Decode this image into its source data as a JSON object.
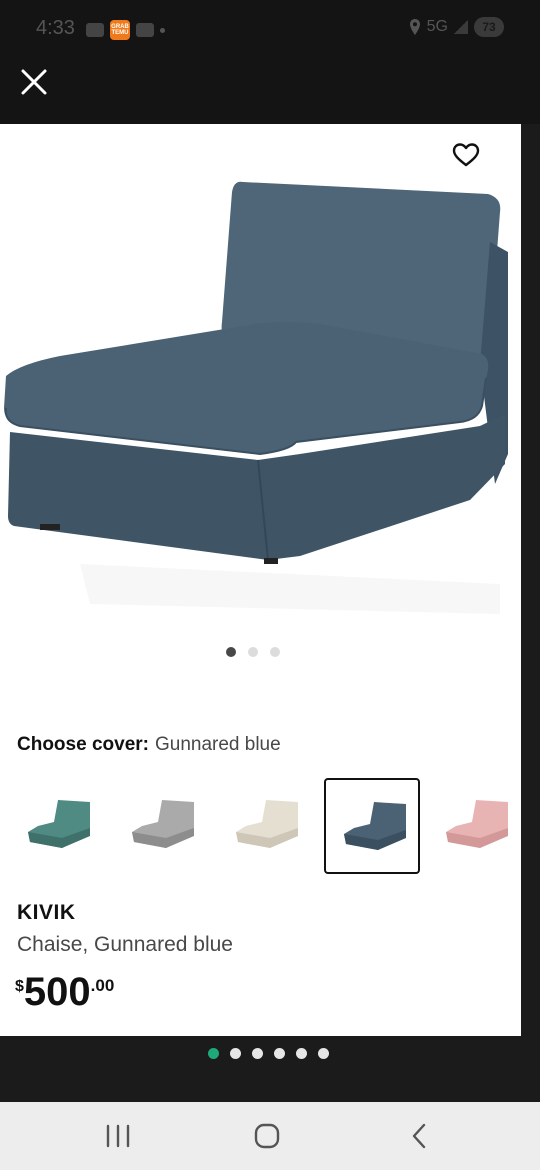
{
  "status_bar": {
    "time": "4:33",
    "temu_badge": "GRAB TEMU",
    "network": "5G",
    "battery": "73"
  },
  "icons": {
    "close": "close-icon",
    "favorite": "heart-outline-icon",
    "recents": "recents-icon",
    "home": "home-icon",
    "back": "back-icon"
  },
  "product": {
    "cover_label": "Choose cover:",
    "cover_value": "Gunnared blue",
    "name": "KIVIK",
    "description": "Chaise, Gunnared blue",
    "price_currency": "$",
    "price_integer": "500",
    "price_decimal": ".00",
    "image_count": 3,
    "active_image": 0,
    "swatches": [
      {
        "name": "teal",
        "color": "#4f8a83"
      },
      {
        "name": "grey",
        "color": "#a8a8a8"
      },
      {
        "name": "beige",
        "color": "#e3ddd0"
      },
      {
        "name": "gunnared-blue",
        "color": "#4b6275",
        "selected": true
      },
      {
        "name": "pink",
        "color": "#e6b0b0"
      }
    ]
  },
  "pager": {
    "count": 6,
    "active": 0
  },
  "colors": {
    "accent_green": "#1fa97a",
    "sofa_blue": "#4b6275"
  }
}
